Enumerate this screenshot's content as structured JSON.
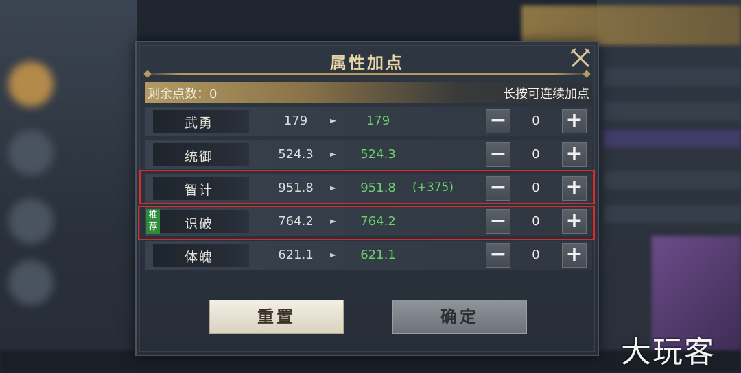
{
  "dialog": {
    "title": "属性加点",
    "close_icon": "crossed-swords-close-icon",
    "points_label": "剩余点数：0",
    "points_hint": "长按可连续加点",
    "minus_symbol": "−",
    "plus_symbol": "+",
    "arrow_symbol": "►",
    "recommend_badge": "推荐",
    "reset_label": "重置",
    "confirm_label": "确定"
  },
  "attributes": [
    {
      "name": "武勇",
      "current": "179",
      "new": "179",
      "bonus": "",
      "count": "0"
    },
    {
      "name": "统御",
      "current": "524.3",
      "new": "524.3",
      "bonus": "",
      "count": "0"
    },
    {
      "name": "智计",
      "current": "951.8",
      "new": "951.8",
      "bonus": "(+375)",
      "count": "0"
    },
    {
      "name": "识破",
      "current": "764.2",
      "new": "764.2",
      "bonus": "",
      "count": "0"
    },
    {
      "name": "体魄",
      "current": "621.1",
      "new": "621.1",
      "bonus": "",
      "count": "0"
    }
  ],
  "watermark": "大玩客",
  "colors": {
    "accent_gold": "#e6d3a6",
    "value_green": "#6bd06b",
    "highlight_red": "#d92b2b",
    "badge_green": "#2f8a3a"
  }
}
